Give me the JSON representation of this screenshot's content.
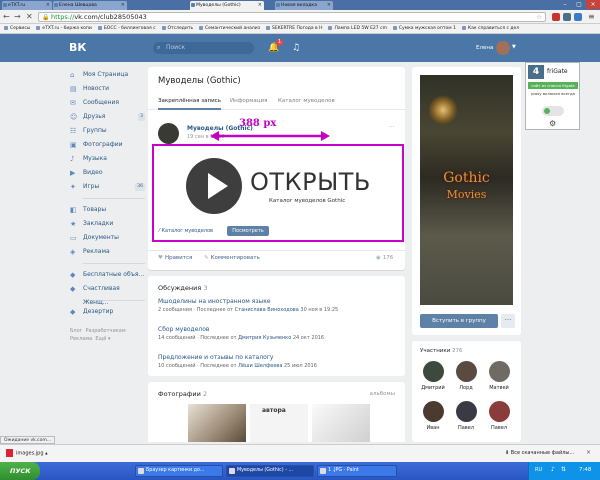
{
  "browser": {
    "tabs": [
      {
        "label": "eTXT.ru"
      },
      {
        "label": "Елена Шевцова"
      },
      {
        "label": "Муводелы (Gothic)"
      },
      {
        "label": "Новая вкладка"
      }
    ],
    "url_https": "https://",
    "url_rest": "vk.com/club28505043",
    "bookmarks": [
      "Сервисы",
      "eTXT.ru - биржа копи",
      "БОСС - биллинговая с",
      "Отследить",
      "Семантический анализ",
      "SEKERTRE Погода в Н",
      "Лампа LED 5W E27 сm",
      "Сумка мужская оптом 1",
      "Как справиться с дел"
    ]
  },
  "vk": {
    "logo": "ВК",
    "search_placeholder": "Поиск",
    "notif_count": "1",
    "user_name": "Елена",
    "nav": [
      {
        "label": "Моя Страница",
        "icon": "home-icon",
        "count": ""
      },
      {
        "label": "Новости",
        "icon": "news-icon",
        "count": ""
      },
      {
        "label": "Сообщения",
        "icon": "messages-icon",
        "count": ""
      },
      {
        "label": "Друзья",
        "icon": "friends-icon",
        "count": "3"
      },
      {
        "label": "Группы",
        "icon": "groups-icon",
        "count": ""
      },
      {
        "label": "Фотографии",
        "icon": "photos-icon",
        "count": ""
      },
      {
        "label": "Музыка",
        "icon": "music-icon",
        "count": ""
      },
      {
        "label": "Видео",
        "icon": "video-icon",
        "count": ""
      },
      {
        "label": "Игры",
        "icon": "games-icon",
        "count": "36"
      }
    ],
    "nav2": [
      {
        "label": "Товары",
        "icon": "goods-icon"
      },
      {
        "label": "Закладки",
        "icon": "bookmarks-icon"
      },
      {
        "label": "Документы",
        "icon": "documents-icon"
      },
      {
        "label": "Реклама",
        "icon": "ads-icon"
      }
    ],
    "nav3": [
      {
        "label": "Бесплатные объя...",
        "icon": "app-icon"
      },
      {
        "label": "Счастливая Женщ...",
        "icon": "app-icon"
      }
    ],
    "nav4": [
      {
        "label": "Дезертир",
        "icon": "app-icon"
      }
    ],
    "nav_footer": [
      "Блог",
      "Разработчикам",
      "Реклама",
      "Ещё"
    ]
  },
  "group": {
    "title": "Муводелы (Gothic)",
    "tabs": [
      "Закреплённая запись",
      "Информация",
      "Каталог муводелов"
    ],
    "post_author": "Муводелы (Gothic)",
    "post_date": "19 сен в 16:19",
    "annotation": "388 px",
    "promo_title": "ОТКРЫТЬ",
    "promo_sub": "Каталог муводелов Gothic",
    "promo_link": "Каталог муводелов",
    "promo_button": "Посмотреть",
    "like_label": "Нравится",
    "comment_label": "Комментировать",
    "views": "176"
  },
  "discussions": {
    "title": "Обсуждения",
    "count": "3",
    "topics": [
      {
        "title": "Мшоделины на иностранном языке",
        "meta_pre": "2 сообщения · Последнее от ",
        "meta_author": "Станислава Виноходова",
        "meta_post": " 30 ноя в 19:25"
      },
      {
        "title": "Сбор муводелов",
        "meta_pre": "14 сообщений · Последнее от ",
        "meta_author": "Дмитрия Кузьменко",
        "meta_post": " 24 окт 2016"
      },
      {
        "title": "Предложение и отзывы по каталогу",
        "meta_pre": "10 сообщений · Последнее от ",
        "meta_author": "Лёши Шелфеева",
        "meta_post": " 25 июл 2016"
      }
    ]
  },
  "photos": {
    "title": "Фотографии",
    "count": "2",
    "albums_link": "альбомы",
    "thumb2_text": "автора"
  },
  "cover": {
    "logo_line1": "Gothic",
    "logo_line2": "Movies",
    "join_button": "Вступить в группу",
    "more_button": "···"
  },
  "members": {
    "title": "Участники",
    "count": "276",
    "list": [
      {
        "name": "Дмитрий",
        "color": "#3b4a3c"
      },
      {
        "name": "Лорд",
        "color": "#5a4a3f"
      },
      {
        "name": "Матвей",
        "color": "#6f6a64"
      },
      {
        "name": "Иван",
        "color": "#4a3a30"
      },
      {
        "name": "Павел",
        "color": "#3a3a44"
      },
      {
        "name": "Павел",
        "color": "#8a3b3b"
      }
    ]
  },
  "frigate": {
    "name": "friGate",
    "green_bar": "сайт из списка frigate",
    "sub": "proxy включен всегда"
  },
  "status": {
    "tooltip": "Ожидание vk.com...",
    "download_file": "images.jpg",
    "download_all": "Все скачанные файлы..."
  },
  "taskbar": {
    "start": "ПУСК",
    "tasks": [
      "Браузер картинки до...",
      "Муводелы (Gothic) - ...",
      "1 .JPG - Paint"
    ],
    "lang": "RU",
    "clock": "7:48"
  }
}
